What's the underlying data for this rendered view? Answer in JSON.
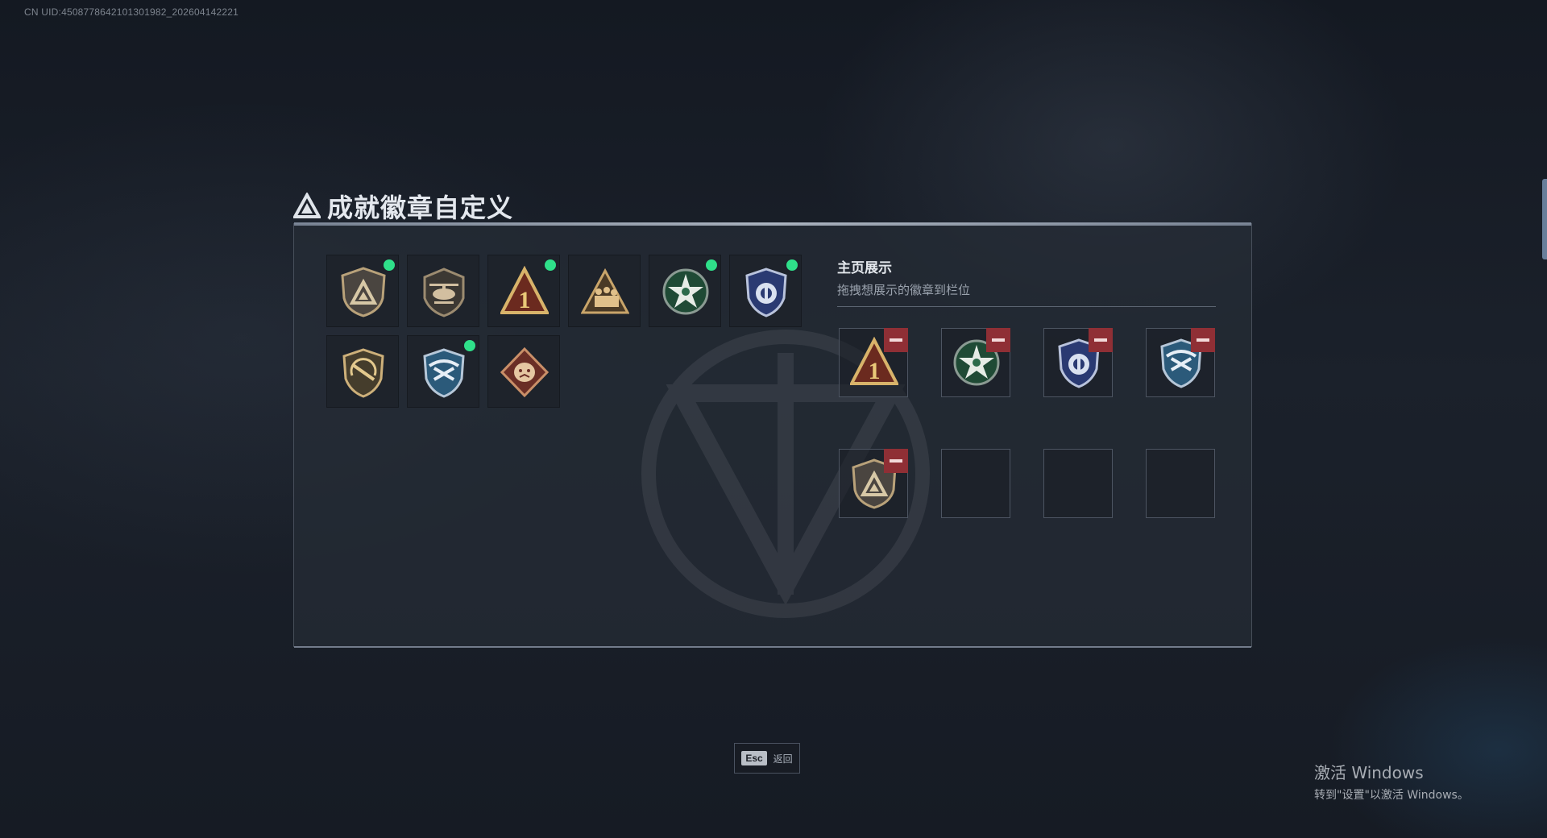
{
  "uid_text": "CN UID:4508778642101301982_202604142221",
  "title": "成就徽章自定义",
  "showcase": {
    "title": "主页展示",
    "subtitle": "拖拽想展示的徽章到栏位"
  },
  "badges": [
    {
      "name": "triangle-shield-badge-icon",
      "is_new": true
    },
    {
      "name": "helicopter-badge-icon",
      "is_new": false
    },
    {
      "name": "number-one-badge-icon",
      "is_new": true
    },
    {
      "name": "soldiers-badge-icon",
      "is_new": false
    },
    {
      "name": "green-star-badge-icon",
      "is_new": true
    },
    {
      "name": "blue-police-badge-icon",
      "is_new": true
    },
    {
      "name": "rifle-shield-badge-icon",
      "is_new": false
    },
    {
      "name": "blue-wings-badge-icon",
      "is_new": true
    },
    {
      "name": "beast-diamond-badge-icon",
      "is_new": false
    }
  ],
  "slots": [
    {
      "badge": "number-one-badge-icon"
    },
    {
      "badge": "green-star-badge-icon"
    },
    {
      "badge": "blue-police-badge-icon"
    },
    {
      "badge": "blue-wings-badge-icon"
    },
    {
      "badge": "triangle-shield-badge-icon"
    },
    {
      "badge": ""
    },
    {
      "badge": ""
    },
    {
      "badge": ""
    }
  ],
  "esc_button": {
    "key": "Esc",
    "label": "返回"
  },
  "windows_activation": {
    "title": "激活 Windows",
    "subtitle": "转到\"设置\"以激活 Windows。"
  },
  "colors": {
    "new_dot": "#2fe08a",
    "remove_button": "#8f2f35"
  }
}
